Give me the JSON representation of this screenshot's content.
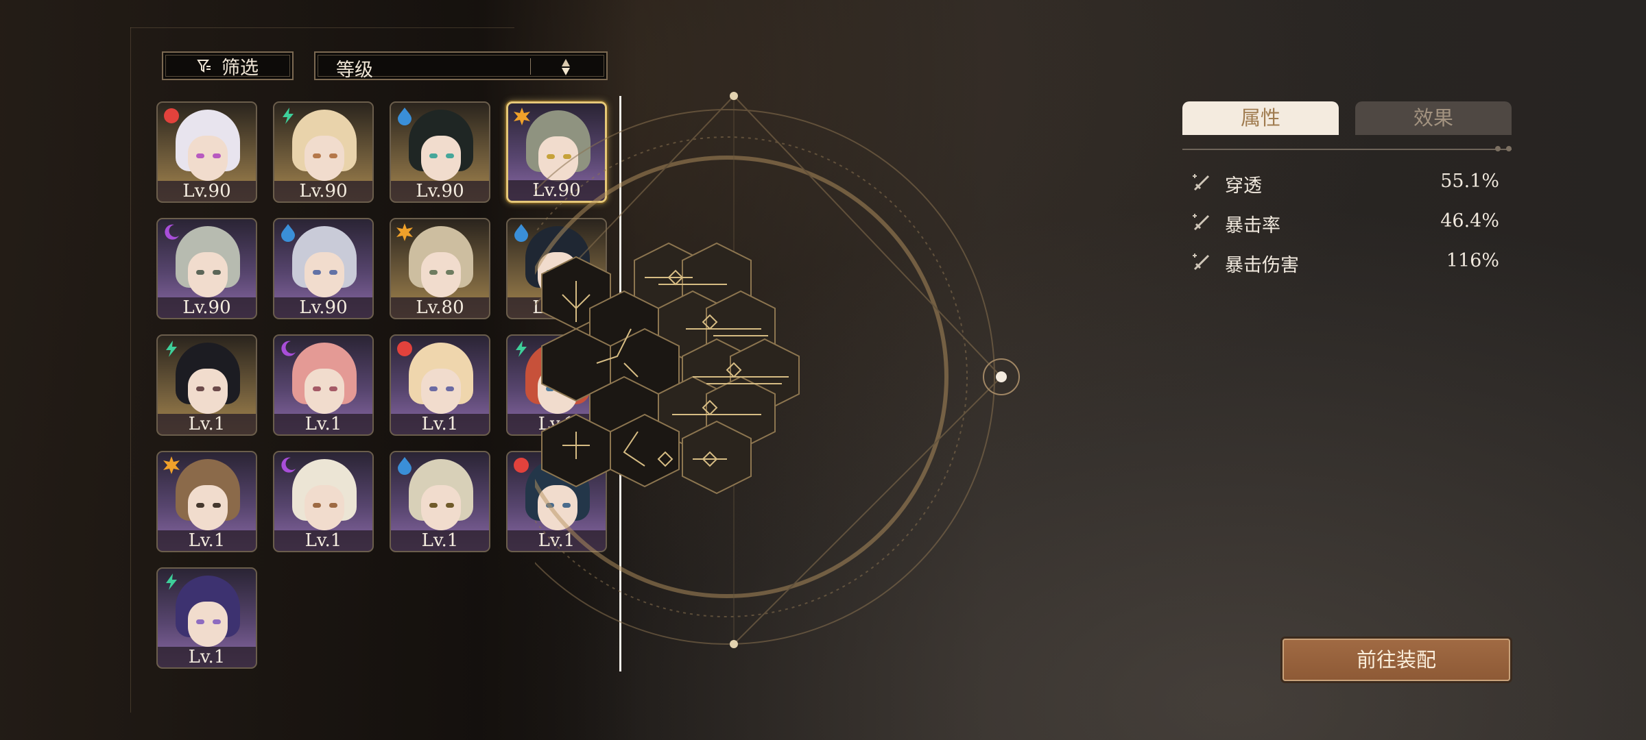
{
  "toolbar": {
    "filter_label": "筛选",
    "sort_label": "等级"
  },
  "characters": [
    {
      "level": "Lv.90",
      "bg": "gold",
      "element": "fire",
      "hair": "#e8e4ee",
      "eyes": "#b85ac0",
      "selected": false
    },
    {
      "level": "Lv.90",
      "bg": "gold",
      "element": "lightning",
      "hair": "#e9d3ab",
      "eyes": "#b5784a",
      "selected": false
    },
    {
      "level": "Lv.90",
      "bg": "gold",
      "element": "water",
      "hair": "#1f2624",
      "eyes": "#46a79a",
      "selected": false
    },
    {
      "level": "Lv.90",
      "bg": "purple",
      "element": "sun",
      "hair": "#8f9380",
      "eyes": "#c6a23a",
      "selected": true
    },
    {
      "level": "Lv.90",
      "bg": "purple",
      "element": "moon",
      "hair": "#b7bbb0",
      "eyes": "#5c6658",
      "selected": false
    },
    {
      "level": "Lv.90",
      "bg": "purple",
      "element": "water",
      "hair": "#c9cbd8",
      "eyes": "#6272a6",
      "selected": false
    },
    {
      "level": "Lv.80",
      "bg": "gold",
      "element": "sun",
      "hair": "#cdbea0",
      "eyes": "#6e7c60",
      "selected": false
    },
    {
      "level": "Lv.70",
      "bg": "gold",
      "element": "water",
      "hair": "#1f2733",
      "eyes": "#3a8f94",
      "selected": false
    },
    {
      "level": "Lv.1",
      "bg": "gold",
      "element": "lightning",
      "hair": "#1c1c22",
      "eyes": "#6b4a4a",
      "selected": false
    },
    {
      "level": "Lv.1",
      "bg": "purple",
      "element": "moon",
      "hair": "#e49a95",
      "eyes": "#a55a66",
      "selected": false
    },
    {
      "level": "Lv.1",
      "bg": "purple",
      "element": "fire",
      "hair": "#efd6ad",
      "eyes": "#6b6aa3",
      "selected": false
    },
    {
      "level": "Lv.1",
      "bg": "purple",
      "element": "lightning",
      "hair": "#c7513a",
      "eyes": "#4d7a9c",
      "selected": false
    },
    {
      "level": "Lv.1",
      "bg": "purple",
      "element": "sun",
      "hair": "#8b6a4a",
      "eyes": "#45382e",
      "selected": false
    },
    {
      "level": "Lv.1",
      "bg": "purple",
      "element": "moon",
      "hair": "#ece5d5",
      "eyes": "#9d6a43",
      "selected": false
    },
    {
      "level": "Lv.1",
      "bg": "purple",
      "element": "water",
      "hair": "#d8d0b8",
      "eyes": "#6f5a2a",
      "selected": false
    },
    {
      "level": "Lv.1",
      "bg": "purple",
      "element": "fire",
      "hair": "#233649",
      "eyes": "#4a6b8c",
      "selected": false
    },
    {
      "level": "Lv.1",
      "bg": "purple",
      "element": "lightning",
      "hair": "#3d3270",
      "eyes": "#8e6cc0",
      "selected": false
    }
  ],
  "tabs": {
    "attributes": "属性",
    "effects": "效果"
  },
  "stats": [
    {
      "name": "穿透",
      "value": "55.1%"
    },
    {
      "name": "暴击率",
      "value": "46.4%"
    },
    {
      "name": "暴击伤害",
      "value": "116%"
    }
  ],
  "equip_button": "前往装配",
  "colors": {
    "accent_gold": "#e6c878",
    "button_brown": "#9a6540",
    "tab_active": "#f4ebdf"
  }
}
